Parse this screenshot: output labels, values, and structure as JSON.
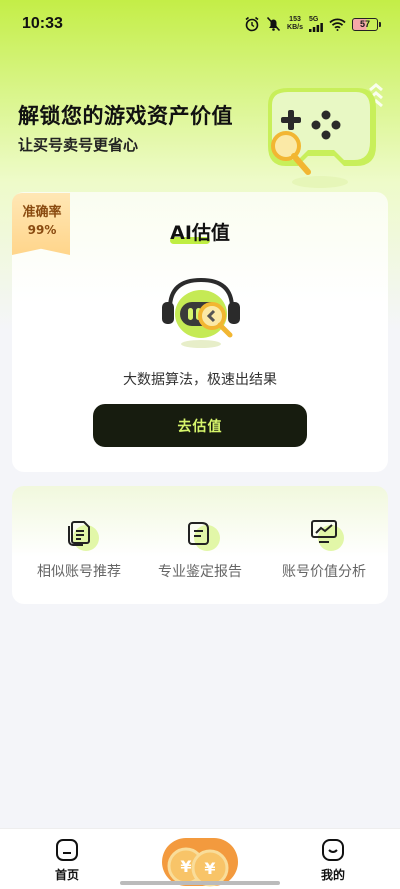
{
  "status_bar": {
    "time": "10:33",
    "net_speed_value": "153",
    "net_speed_unit": "KB/s",
    "network_type": "5G",
    "battery": "57"
  },
  "hero": {
    "title": "解锁您的游戏资产价值",
    "subtitle": "让买号卖号更省心"
  },
  "valuation_card": {
    "badge_title": "准确率",
    "badge_value": "99%",
    "title": "AI估值",
    "description": "大数据算法，极速出结果",
    "button_label": "去估值"
  },
  "features": [
    {
      "label": "相似账号推荐",
      "icon": "documents-icon"
    },
    {
      "label": "专业鉴定报告",
      "icon": "report-icon"
    },
    {
      "label": "账号价值分析",
      "icon": "chart-monitor-icon"
    }
  ],
  "bottom_nav": {
    "home_label": "首页",
    "mine_label": "我的"
  },
  "colors": {
    "accent": "#c4ee47",
    "button_bg": "#171c0f",
    "button_text": "#d6f56b",
    "badge": "#ffd58b"
  }
}
